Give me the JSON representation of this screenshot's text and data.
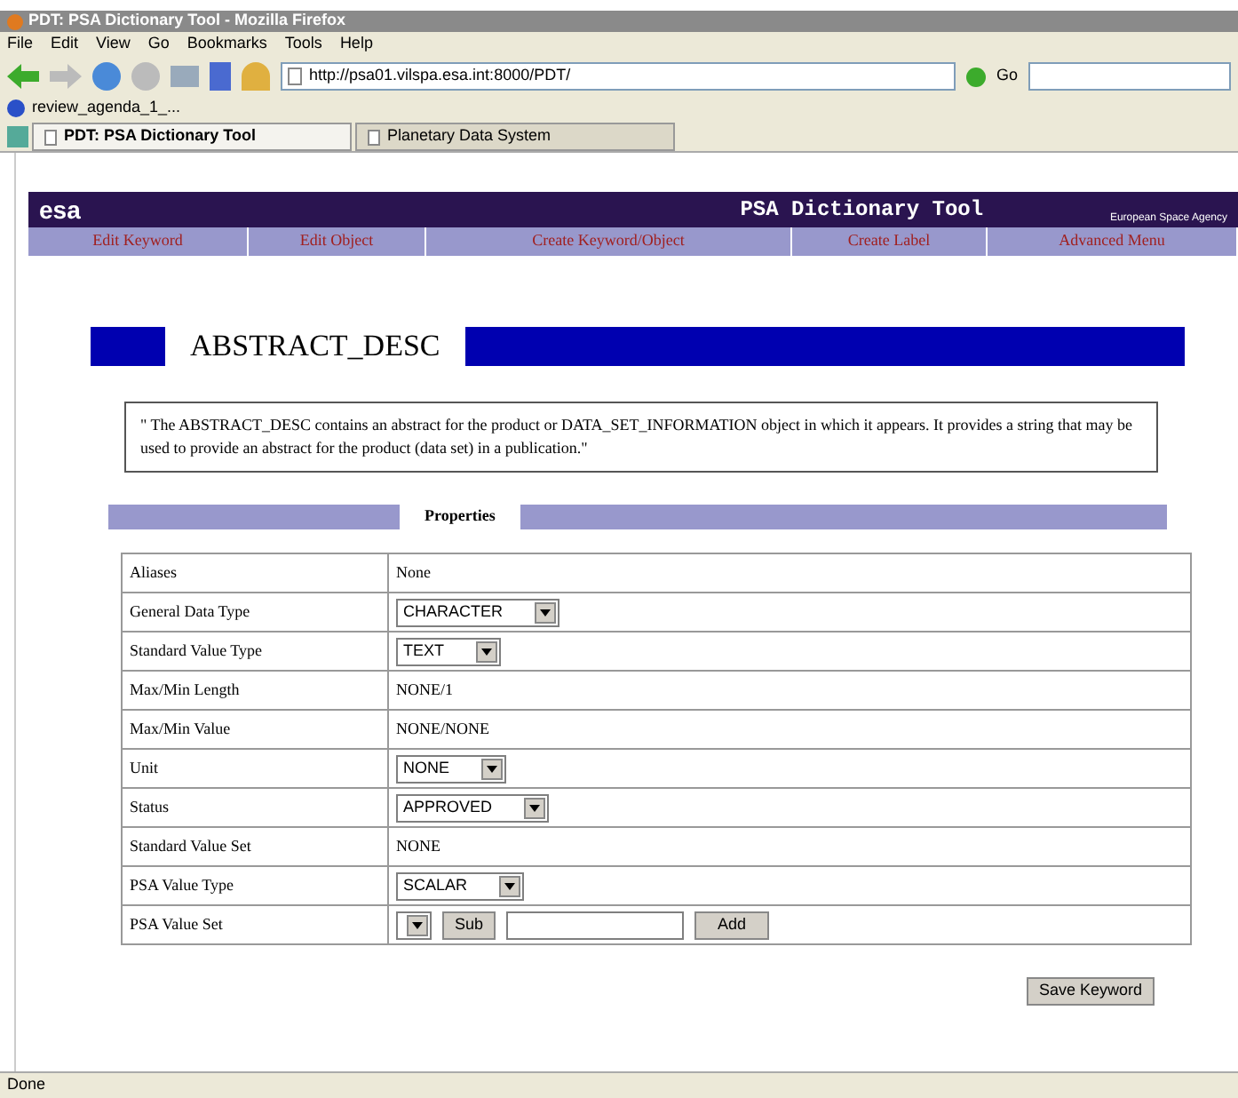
{
  "window": {
    "title": "PDT: PSA Dictionary Tool - Mozilla Firefox"
  },
  "menu": [
    "File",
    "Edit",
    "View",
    "Go",
    "Bookmarks",
    "Tools",
    "Help"
  ],
  "address": {
    "value": "http://psa01.vilspa.esa.int:8000/PDT/"
  },
  "go_label": "Go",
  "bookmarks": [
    "review_agenda_1_..."
  ],
  "tabs": [
    {
      "label": "PDT: PSA Dictionary Tool",
      "selected": true
    },
    {
      "label": "Planetary Data System",
      "selected": false
    }
  ],
  "banner": {
    "logo": "esa",
    "title": "PSA Dictionary Tool",
    "agency": "European Space Agency"
  },
  "nav": [
    "Edit Keyword",
    "Edit Object",
    "Create Keyword/Object",
    "Create Label",
    "Advanced Menu"
  ],
  "heading": "ABSTRACT_DESC",
  "description": "\" The ABSTRACT_DESC contains an abstract for the product or DATA_SET_INFORMATION object in which it appears. It provides a string that may be used to provide an abstract for the product (data set) in a publication.\"",
  "properties_label": "Properties",
  "rows": [
    {
      "label": "Aliases",
      "kind": "text",
      "value": "None"
    },
    {
      "label": "General Data Type",
      "kind": "select",
      "value": "CHARACTER"
    },
    {
      "label": "Standard Value Type",
      "kind": "select",
      "value": "TEXT"
    },
    {
      "label": "Max/Min Length",
      "kind": "text",
      "value": "NONE/1"
    },
    {
      "label": "Max/Min Value",
      "kind": "text",
      "value": "NONE/NONE"
    },
    {
      "label": "Unit",
      "kind": "select",
      "value": "NONE"
    },
    {
      "label": "Status",
      "kind": "select",
      "value": "APPROVED"
    },
    {
      "label": "Standard Value Set",
      "kind": "text",
      "value": "NONE"
    },
    {
      "label": "PSA Value Type",
      "kind": "select",
      "value": "SCALAR"
    },
    {
      "label": "PSA Value Set",
      "kind": "valueset",
      "sub": "Sub",
      "add": "Add"
    }
  ],
  "save_button": "Save Keyword",
  "status_bar": "Done"
}
